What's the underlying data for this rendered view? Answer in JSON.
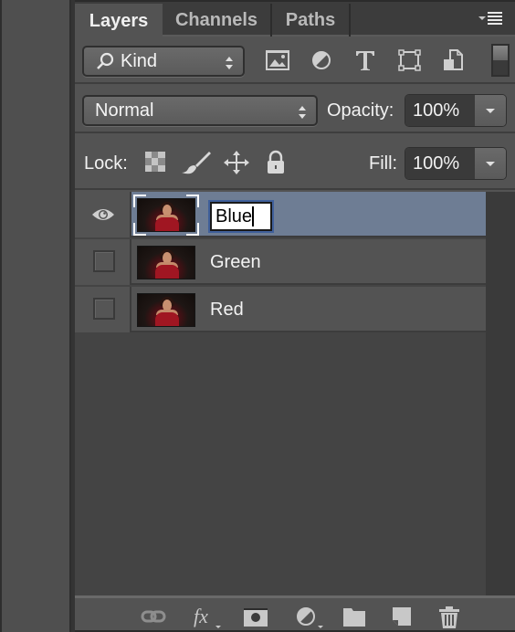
{
  "panel": {
    "tabs": [
      {
        "label": "Layers",
        "active": true
      },
      {
        "label": "Channels",
        "active": false
      },
      {
        "label": "Paths",
        "active": false
      }
    ],
    "menu_icon": "panel-menu-icon"
  },
  "filter": {
    "kind_label": "Kind",
    "search_icon": "search-icon",
    "filter_icons": [
      "pixel-layer-filter-icon",
      "adjustment-layer-filter-icon",
      "type-layer-filter-icon",
      "shape-layer-filter-icon",
      "smart-object-filter-icon"
    ],
    "filter_toggle": "filter-toggle-switch"
  },
  "blend": {
    "mode": "Normal",
    "opacity_label": "Opacity:",
    "opacity_value": "100%"
  },
  "lock": {
    "label": "Lock:",
    "icons": [
      "lock-transparent-pixels-icon",
      "lock-image-pixels-icon",
      "lock-position-icon",
      "lock-all-icon"
    ],
    "fill_label": "Fill:",
    "fill_value": "100%"
  },
  "layers": [
    {
      "name": "Blue",
      "visible": true,
      "selected": true,
      "editing": true
    },
    {
      "name": "Green",
      "visible": false,
      "selected": false,
      "editing": false
    },
    {
      "name": "Red",
      "visible": false,
      "selected": false,
      "editing": false
    }
  ],
  "bottom_bar": {
    "icons": [
      "link-layers-icon",
      "layer-style-fx-icon",
      "add-mask-icon",
      "new-adjustment-layer-icon",
      "new-group-icon",
      "new-layer-icon",
      "delete-layer-icon"
    ]
  },
  "colors": {
    "selection": "#6e7d94",
    "panel_bg": "#535353",
    "list_bg": "#444444"
  }
}
